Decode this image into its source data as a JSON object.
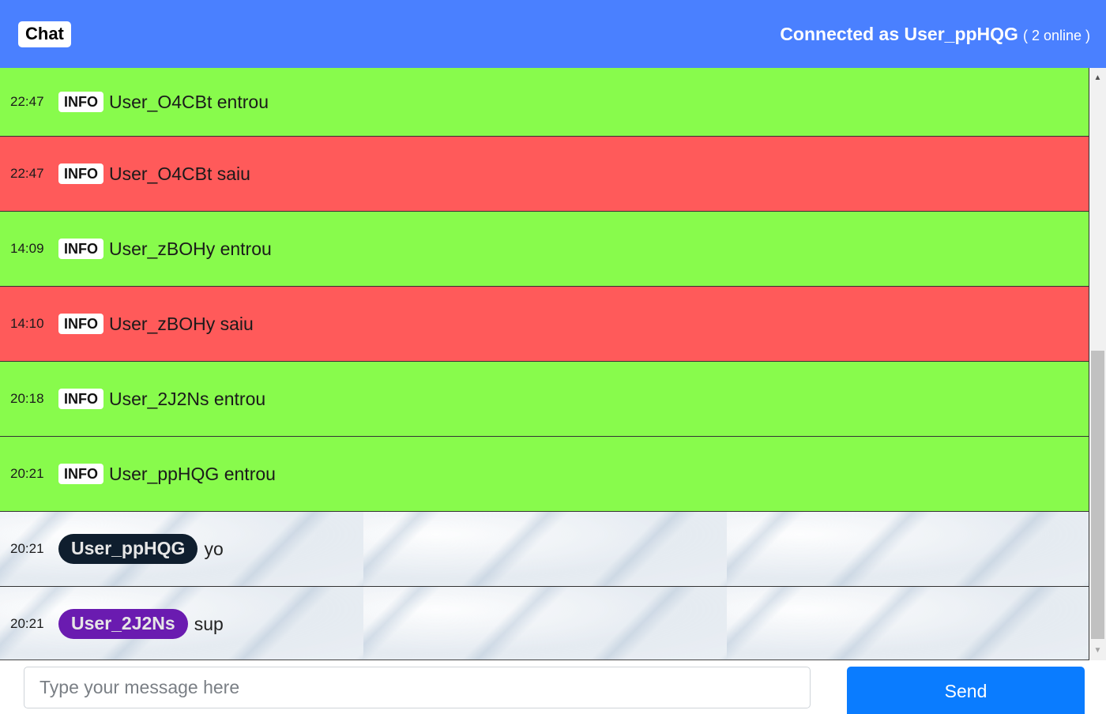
{
  "header": {
    "brand": "Chat",
    "connected_label": "Connected as User_ppHQG",
    "online_count": "( 2 online )"
  },
  "messages": [
    {
      "time": "22:47",
      "badge": "INFO",
      "text": "User_O4CBt entrou"
    },
    {
      "time": "22:47",
      "badge": "INFO",
      "text": "User_O4CBt saiu"
    },
    {
      "time": "14:09",
      "badge": "INFO",
      "text": "User_zBOHy entrou"
    },
    {
      "time": "14:10",
      "badge": "INFO",
      "text": "User_zBOHy saiu"
    },
    {
      "time": "20:18",
      "badge": "INFO",
      "text": "User_2J2Ns entrou"
    },
    {
      "time": "20:21",
      "badge": "INFO",
      "text": "User_ppHQG entrou"
    },
    {
      "time": "20:21",
      "user": "User_ppHQG",
      "text": "yo"
    },
    {
      "time": "20:21",
      "user": "User_2J2Ns",
      "text": "sup"
    }
  ],
  "colors": {
    "header": "#4a80ff",
    "join_row": "#88fb4c",
    "leave_row": "#ff5a5a",
    "user_ppHQG_badge": "#0f1e2e",
    "user_2J2Ns_badge": "#6a1bb0",
    "send_button": "#0a7cff"
  },
  "icons": {
    "scroll_up": "arrow-up-icon",
    "scroll_down": "arrow-down-icon"
  },
  "composer": {
    "placeholder": "Type your message here",
    "value": "",
    "send_label": "Send"
  }
}
